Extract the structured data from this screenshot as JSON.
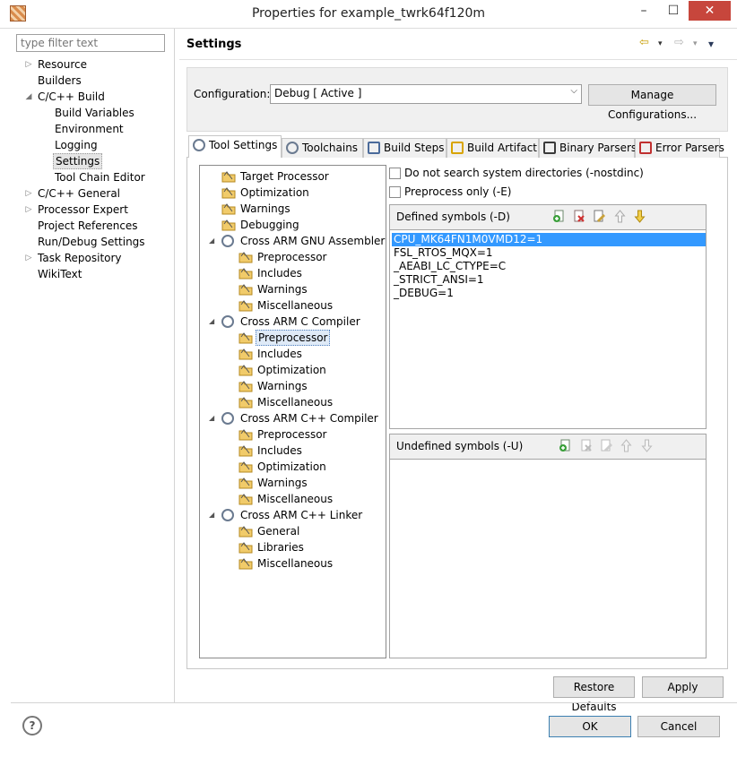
{
  "window": {
    "title": "Properties for example_twrk64f120m",
    "minimize": "–",
    "maximize": "☐",
    "close": "✕"
  },
  "filter": {
    "placeholder": "type filter text"
  },
  "nav": [
    {
      "label": "Resource",
      "arrow": "▷"
    },
    {
      "label": "Builders",
      "arrow": ""
    },
    {
      "label": "C/C++ Build",
      "arrow": "◢"
    },
    {
      "label": "Build Variables",
      "arrow": ""
    },
    {
      "label": "Environment",
      "arrow": ""
    },
    {
      "label": "Logging",
      "arrow": ""
    },
    {
      "label": "Settings",
      "arrow": "",
      "selected": true
    },
    {
      "label": "Tool Chain Editor",
      "arrow": ""
    },
    {
      "label": "C/C++ General",
      "arrow": "▷"
    },
    {
      "label": "Processor Expert",
      "arrow": "▷"
    },
    {
      "label": "Project References",
      "arrow": ""
    },
    {
      "label": "Run/Debug Settings",
      "arrow": ""
    },
    {
      "label": "Task Repository",
      "arrow": "▷"
    },
    {
      "label": "WikiText",
      "arrow": ""
    }
  ],
  "header": {
    "title": "Settings",
    "back_icon": "⇦",
    "forward_icon": "⇨",
    "menu_icon": "▾"
  },
  "config": {
    "label": "Configuration:",
    "value": "Debug  [ Active ]",
    "manage_label": "Manage Configurations..."
  },
  "tabs": [
    {
      "label": "Tool Settings",
      "active": true
    },
    {
      "label": "Toolchains"
    },
    {
      "label": "Build Steps"
    },
    {
      "label": "Build Artifact"
    },
    {
      "label": "Binary Parsers"
    },
    {
      "label": "Error Parsers"
    }
  ],
  "tool_tree": [
    {
      "label": "Target Processor",
      "level": 0,
      "icon": "folder"
    },
    {
      "label": "Optimization",
      "level": 0,
      "icon": "folder"
    },
    {
      "label": "Warnings",
      "level": 0,
      "icon": "folder"
    },
    {
      "label": "Debugging",
      "level": 0,
      "icon": "folder"
    },
    {
      "label": "Cross ARM GNU Assembler",
      "level": 0,
      "icon": "gear",
      "expanded": true
    },
    {
      "label": "Preprocessor",
      "level": 1,
      "icon": "folder"
    },
    {
      "label": "Includes",
      "level": 1,
      "icon": "folder"
    },
    {
      "label": "Warnings",
      "level": 1,
      "icon": "folder"
    },
    {
      "label": "Miscellaneous",
      "level": 1,
      "icon": "folder"
    },
    {
      "label": "Cross ARM C Compiler",
      "level": 0,
      "icon": "gear",
      "expanded": true
    },
    {
      "label": "Preprocessor",
      "level": 1,
      "icon": "folder",
      "selected": true
    },
    {
      "label": "Includes",
      "level": 1,
      "icon": "folder"
    },
    {
      "label": "Optimization",
      "level": 1,
      "icon": "folder"
    },
    {
      "label": "Warnings",
      "level": 1,
      "icon": "folder"
    },
    {
      "label": "Miscellaneous",
      "level": 1,
      "icon": "folder"
    },
    {
      "label": "Cross ARM C++ Compiler",
      "level": 0,
      "icon": "gear",
      "expanded": true
    },
    {
      "label": "Preprocessor",
      "level": 1,
      "icon": "folder"
    },
    {
      "label": "Includes",
      "level": 1,
      "icon": "folder"
    },
    {
      "label": "Optimization",
      "level": 1,
      "icon": "folder"
    },
    {
      "label": "Warnings",
      "level": 1,
      "icon": "folder"
    },
    {
      "label": "Miscellaneous",
      "level": 1,
      "icon": "folder"
    },
    {
      "label": "Cross ARM C++ Linker",
      "level": 0,
      "icon": "gear",
      "expanded": true
    },
    {
      "label": "General",
      "level": 1,
      "icon": "folder"
    },
    {
      "label": "Libraries",
      "level": 1,
      "icon": "folder"
    },
    {
      "label": "Miscellaneous",
      "level": 1,
      "icon": "folder"
    }
  ],
  "options": {
    "nostdinc_label": "Do not search system directories (-nostdinc)",
    "preprocess_only_label": "Preprocess only (-E)"
  },
  "defined": {
    "title": "Defined symbols (-D)",
    "items": [
      "CPU_MK64FN1M0VMD12=1",
      "FSL_RTOS_MQX=1",
      "_AEABI_LC_CTYPE=C",
      "_STRICT_ANSI=1",
      "_DEBUG=1"
    ]
  },
  "undefined": {
    "title": "Undefined symbols (-U)",
    "items": []
  },
  "buttons": {
    "restore": "Restore Defaults",
    "apply": "Apply",
    "ok": "OK",
    "cancel": "Cancel",
    "help": "?"
  },
  "colors": {
    "selection": "#3399ff",
    "close_red": "#c7463c",
    "folder": "#e8b84a"
  }
}
